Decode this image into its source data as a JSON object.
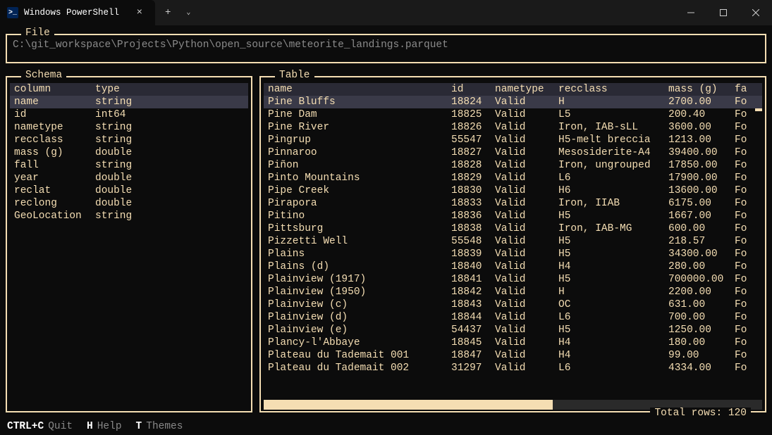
{
  "titlebar": {
    "tab_title": "Windows PowerShell"
  },
  "file": {
    "label": "File",
    "path": "C:\\git_workspace\\Projects\\Python\\open_source\\meteorite_landings.parquet"
  },
  "schema": {
    "label": "Schema",
    "header": {
      "c1": "column",
      "c2": "type"
    },
    "rows": [
      {
        "c1": "name",
        "c2": "string",
        "selected": true
      },
      {
        "c1": "id",
        "c2": "int64"
      },
      {
        "c1": "nametype",
        "c2": "string"
      },
      {
        "c1": "recclass",
        "c2": "string"
      },
      {
        "c1": "mass (g)",
        "c2": "double"
      },
      {
        "c1": "fall",
        "c2": "string"
      },
      {
        "c1": "year",
        "c2": "double"
      },
      {
        "c1": "reclat",
        "c2": "double"
      },
      {
        "c1": "reclong",
        "c2": "double"
      },
      {
        "c1": "GeoLocation",
        "c2": "string"
      }
    ]
  },
  "table": {
    "label": "Table",
    "header": {
      "name": "name",
      "id": "id",
      "nt": "nametype",
      "rc": "recclass",
      "mass": "mass (g)",
      "fa": "fa"
    },
    "rows": [
      {
        "name": "Pine Bluffs",
        "id": "18824",
        "nt": "Valid",
        "rc": "H",
        "mass": "2700.00",
        "fa": "Fo",
        "selected": true
      },
      {
        "name": "Pine Dam",
        "id": "18825",
        "nt": "Valid",
        "rc": "L5",
        "mass": "200.40",
        "fa": "Fo"
      },
      {
        "name": "Pine River",
        "id": "18826",
        "nt": "Valid",
        "rc": "Iron, IAB-sLL",
        "mass": "3600.00",
        "fa": "Fo"
      },
      {
        "name": "Pingrup",
        "id": "55547",
        "nt": "Valid",
        "rc": "H5-melt breccia",
        "mass": "1213.00",
        "fa": "Fo"
      },
      {
        "name": "Pinnaroo",
        "id": "18827",
        "nt": "Valid",
        "rc": "Mesosiderite-A4",
        "mass": "39400.00",
        "fa": "Fo"
      },
      {
        "name": "Piñon",
        "id": "18828",
        "nt": "Valid",
        "rc": "Iron, ungrouped",
        "mass": "17850.00",
        "fa": "Fo"
      },
      {
        "name": "Pinto Mountains",
        "id": "18829",
        "nt": "Valid",
        "rc": "L6",
        "mass": "17900.00",
        "fa": "Fo"
      },
      {
        "name": "Pipe Creek",
        "id": "18830",
        "nt": "Valid",
        "rc": "H6",
        "mass": "13600.00",
        "fa": "Fo"
      },
      {
        "name": "Pirapora",
        "id": "18833",
        "nt": "Valid",
        "rc": "Iron, IIAB",
        "mass": "6175.00",
        "fa": "Fo"
      },
      {
        "name": "Pitino",
        "id": "18836",
        "nt": "Valid",
        "rc": "H5",
        "mass": "1667.00",
        "fa": "Fo"
      },
      {
        "name": "Pittsburg",
        "id": "18838",
        "nt": "Valid",
        "rc": "Iron, IAB-MG",
        "mass": "600.00",
        "fa": "Fo"
      },
      {
        "name": "Pizzetti Well",
        "id": "55548",
        "nt": "Valid",
        "rc": "H5",
        "mass": "218.57",
        "fa": "Fo"
      },
      {
        "name": "Plains",
        "id": "18839",
        "nt": "Valid",
        "rc": "H5",
        "mass": "34300.00",
        "fa": "Fo"
      },
      {
        "name": "Plains (d)",
        "id": "18840",
        "nt": "Valid",
        "rc": "H4",
        "mass": "280.00",
        "fa": "Fo"
      },
      {
        "name": "Plainview (1917)",
        "id": "18841",
        "nt": "Valid",
        "rc": "H5",
        "mass": "700000.00",
        "fa": "Fo"
      },
      {
        "name": "Plainview (1950)",
        "id": "18842",
        "nt": "Valid",
        "rc": "H",
        "mass": "2200.00",
        "fa": "Fo"
      },
      {
        "name": "Plainview (c)",
        "id": "18843",
        "nt": "Valid",
        "rc": "OC",
        "mass": "631.00",
        "fa": "Fo"
      },
      {
        "name": "Plainview (d)",
        "id": "18844",
        "nt": "Valid",
        "rc": "L6",
        "mass": "700.00",
        "fa": "Fo"
      },
      {
        "name": "Plainview (e)",
        "id": "54437",
        "nt": "Valid",
        "rc": "H5",
        "mass": "1250.00",
        "fa": "Fo"
      },
      {
        "name": "Plancy-l'Abbaye",
        "id": "18845",
        "nt": "Valid",
        "rc": "H4",
        "mass": "180.00",
        "fa": "Fo"
      },
      {
        "name": "Plateau du Tademait 001",
        "id": "18847",
        "nt": "Valid",
        "rc": "H4",
        "mass": "99.00",
        "fa": "Fo"
      },
      {
        "name": "Plateau du Tademait 002",
        "id": "31297",
        "nt": "Valid",
        "rc": "L6",
        "mass": "4334.00",
        "fa": "Fo"
      }
    ],
    "total_rows": "Total rows: 120"
  },
  "footer": {
    "k1": "CTRL+C",
    "a1": "Quit",
    "k2": "H",
    "a2": "Help",
    "k3": "T",
    "a3": "Themes"
  }
}
